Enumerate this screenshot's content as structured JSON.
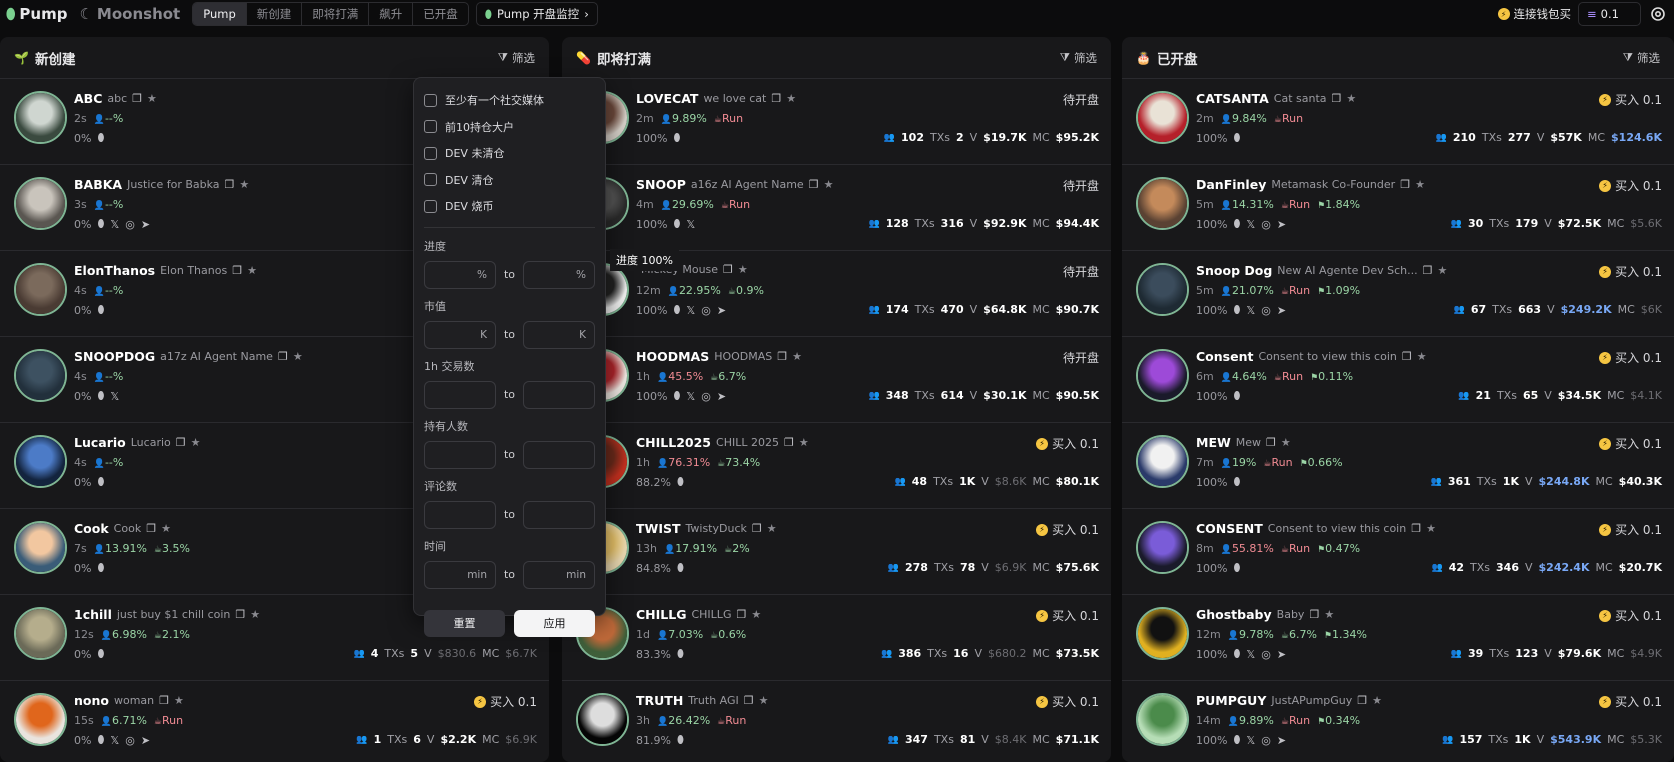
{
  "topbar": {
    "brand1": "Pump",
    "brand2": "Moonshot",
    "tabs": [
      "Pump",
      "新创建",
      "即将打满",
      "飙升",
      "已开盘"
    ],
    "monitor": "Pump 开盘监控",
    "wallet": "连接钱包买",
    "sol_value": "0.1"
  },
  "colors": {
    "accent_green": "#9bd5a6",
    "accent_red": "#f08b93",
    "mc_blue": "#79a8f5",
    "bg": "#0c0c0d",
    "panel": "#18181a"
  },
  "filter_label": "筛选",
  "columns": [
    {
      "title": "新创建",
      "icon": "seedling-icon",
      "rows": [
        {
          "sym": "ABC",
          "name": "abc",
          "age": "2s",
          "p1": "--%",
          "p2": "",
          "p3": "",
          "pct": "0%",
          "links": [],
          "status": "",
          "holders": "",
          "txs": "",
          "vol": "",
          "mc": "",
          "mcblue": false
        },
        {
          "sym": "BABKA",
          "name": "Justice for Babka",
          "age": "3s",
          "p1": "--%",
          "p2": "",
          "p3": "",
          "pct": "0%",
          "links": [
            "x",
            "web",
            "tg"
          ],
          "status": "",
          "holders": "",
          "txs": "",
          "vol": "",
          "mc": "",
          "mcblue": false
        },
        {
          "sym": "ElonThanos",
          "name": "Elon Thanos",
          "age": "4s",
          "p1": "--%",
          "p2": "",
          "p3": "",
          "pct": "0%",
          "links": [],
          "status": "",
          "holders": "",
          "txs": "",
          "vol": "",
          "mc": "",
          "mcblue": false
        },
        {
          "sym": "SNOOPDOG",
          "name": "a17z AI Agent Name",
          "age": "4s",
          "p1": "--%",
          "p2": "",
          "p3": "",
          "pct": "0%",
          "links": [
            "x"
          ],
          "status": "",
          "holders": "",
          "txs": "",
          "vol": "",
          "mc": "",
          "mcblue": false
        },
        {
          "sym": "Lucario",
          "name": "Lucario",
          "age": "4s",
          "p1": "--%",
          "p2": "",
          "p3": "",
          "pct": "0%",
          "links": [],
          "status": "",
          "holders": "",
          "txs": "",
          "vol": "",
          "mc": "",
          "mcblue": false
        },
        {
          "sym": "Cook",
          "name": "Cook",
          "age": "7s",
          "p1": "13.91%",
          "p2": "3.5%",
          "p3": "",
          "pct": "0%",
          "links": [],
          "status": "",
          "holders": "",
          "txs": "",
          "vol": "",
          "mc": "",
          "mcblue": false
        },
        {
          "sym": "1chill",
          "name": "just buy $1 chill coin",
          "age": "12s",
          "p1": "6.98%",
          "p2": "2.1%",
          "p3": "",
          "pct": "0%",
          "links": [],
          "status": "",
          "holders": "4",
          "txs": "5",
          "vol": "$830.6",
          "mc": "$6.7K",
          "mcblue": false,
          "vdim": true,
          "mdim": true
        },
        {
          "sym": "nono",
          "name": "woman",
          "age": "15s",
          "p1": "6.71%",
          "p2": "Run",
          "p3": "",
          "pct": "0%",
          "links": [
            "x",
            "web",
            "tg"
          ],
          "status": "买入 0.1",
          "holders": "1",
          "txs": "6",
          "vol": "$2.2K",
          "mc": "$6.9K",
          "mcblue": false,
          "mdim": true
        }
      ]
    },
    {
      "title": "即将打满",
      "icon": "pill-icon",
      "rows": [
        {
          "sym": "LOVECAT",
          "name": "we love cat",
          "age": "2m",
          "p1": "9.89%",
          "p2": "Run",
          "p3": "",
          "pct": "100%",
          "links": [],
          "status": "待开盘",
          "holders": "102",
          "txs": "2",
          "vol": "$19.7K",
          "mc": "$95.2K"
        },
        {
          "sym": "SNOOP",
          "name": "a16z AI Agent Name",
          "age": "4m",
          "p1": "29.69%",
          "p2": "Run",
          "p3": "",
          "pct": "100%",
          "links": [
            "x"
          ],
          "status": "待开盘",
          "holders": "128",
          "txs": "316",
          "vol": "$92.9K",
          "mc": "$94.4K"
        },
        {
          "sym": "",
          "name": "Mickey Mouse",
          "age": "12m",
          "p1": "22.95%",
          "p2": "0.9%",
          "p3": "",
          "pct": "100%",
          "links": [
            "x",
            "web",
            "tg"
          ],
          "status": "待开盘",
          "holders": "174",
          "txs": "470",
          "vol": "$64.8K",
          "mc": "$90.7K"
        },
        {
          "sym": "HOODMAS",
          "name": "HOODMAS",
          "age": "1h",
          "p1": "45.5%",
          "p2": "6.7%",
          "p3": "",
          "pct": "100%",
          "links": [
            "x",
            "web",
            "tg"
          ],
          "status": "待开盘",
          "holders": "348",
          "txs": "614",
          "vol": "$30.1K",
          "mc": "$90.5K",
          "p1red": true
        },
        {
          "sym": "CHILL2025",
          "name": "CHILL 2025",
          "age": "1h",
          "p1": "76.31%",
          "p2": "73.4%",
          "p3": "",
          "pct": "88.2%",
          "links": [],
          "status": "买入 0.1",
          "holders": "48",
          "txs": "1K",
          "vol": "$8.6K",
          "mc": "$80.1K",
          "p1red": true,
          "vdim": true
        },
        {
          "sym": "TWIST",
          "name": "TwistyDuck",
          "age": "13h",
          "p1": "17.91%",
          "p2": "2%",
          "p3": "",
          "pct": "84.8%",
          "links": [],
          "status": "买入 0.1",
          "holders": "278",
          "txs": "78",
          "vol": "$6.9K",
          "mc": "$75.6K",
          "vdim": true
        },
        {
          "sym": "CHILLG",
          "name": "CHILLG",
          "age": "1d",
          "p1": "7.03%",
          "p2": "0.6%",
          "p3": "",
          "pct": "83.3%",
          "links": [],
          "status": "买入 0.1",
          "holders": "386",
          "txs": "16",
          "vol": "$680.2",
          "mc": "$73.5K",
          "vdim": true
        },
        {
          "sym": "TRUTH",
          "name": "Truth AGI",
          "age": "3h",
          "p1": "26.42%",
          "p2": "Run",
          "p3": "",
          "pct": "81.9%",
          "links": [],
          "status": "买入 0.1",
          "holders": "347",
          "txs": "81",
          "vol": "$8.4K",
          "mc": "$71.1K",
          "vdim": true
        }
      ]
    },
    {
      "title": "已开盘",
      "icon": "cake-icon",
      "rows": [
        {
          "sym": "CATSANTA",
          "name": "Cat santa",
          "age": "2m",
          "p1": "9.84%",
          "p2": "Run",
          "p3": "",
          "pct": "100%",
          "links": [],
          "status": "买入 0.1",
          "holders": "210",
          "txs": "277",
          "vol": "$57K",
          "mc": "$124.6K",
          "mcblue": true
        },
        {
          "sym": "DanFinley",
          "name": "Metamask Co-Founder",
          "age": "5m",
          "p1": "14.31%",
          "p2": "Run",
          "p3": "1.84%",
          "pct": "100%",
          "links": [
            "x",
            "web",
            "tg"
          ],
          "status": "买入 0.1",
          "holders": "30",
          "txs": "179",
          "vol": "$72.5K",
          "mc": "$5.6K",
          "mdim": true
        },
        {
          "sym": "Snoop Dog",
          "name": "New AI Agente Dev Sch...",
          "age": "5m",
          "p1": "21.07%",
          "p2": "Run",
          "p3": "1.09%",
          "pct": "100%",
          "links": [
            "x",
            "web",
            "tg"
          ],
          "status": "买入 0.1",
          "holders": "67",
          "txs": "663",
          "vol": "$249.2K",
          "mc": "$6K",
          "vblue": true,
          "mdim": true
        },
        {
          "sym": "Consent",
          "name": "Consent to view this coin",
          "age": "6m",
          "p1": "4.64%",
          "p2": "Run",
          "p3": "0.11%",
          "pct": "100%",
          "links": [],
          "status": "买入 0.1",
          "holders": "21",
          "txs": "65",
          "vol": "$34.5K",
          "mc": "$4.1K",
          "mdim": true
        },
        {
          "sym": "MEW",
          "name": "Mew",
          "age": "7m",
          "p1": "19%",
          "p2": "Run",
          "p3": "0.66%",
          "pct": "100%",
          "links": [],
          "status": "买入 0.1",
          "holders": "361",
          "txs": "1K",
          "vol": "$244.8K",
          "mc": "$40.3K",
          "vblue": true
        },
        {
          "sym": "CONSENT",
          "name": "Consent to view this coin",
          "age": "8m",
          "p1": "55.81%",
          "p2": "Run",
          "p3": "0.47%",
          "pct": "100%",
          "links": [],
          "status": "买入 0.1",
          "holders": "42",
          "txs": "346",
          "vol": "$242.4K",
          "mc": "$20.7K",
          "vblue": true,
          "p1red": true
        },
        {
          "sym": "Ghostbaby",
          "name": "Baby",
          "age": "12m",
          "p1": "9.78%",
          "p2": "6.7%",
          "p3": "1.34%",
          "pct": "100%",
          "links": [
            "x",
            "web",
            "tg"
          ],
          "status": "买入 0.1",
          "holders": "39",
          "txs": "123",
          "vol": "$79.6K",
          "mc": "$4.9K",
          "mdim": true
        },
        {
          "sym": "PUMPGUY",
          "name": "JustAPumpGuy",
          "age": "14m",
          "p1": "9.89%",
          "p2": "Run",
          "p3": "0.34%",
          "pct": "100%",
          "links": [
            "x",
            "web",
            "tg"
          ],
          "status": "买入 0.1",
          "holders": "157",
          "txs": "1K",
          "vol": "$543.9K",
          "mc": "$5.3K",
          "vblue": true,
          "mdim": true
        }
      ]
    }
  ],
  "popup": {
    "checks": [
      "至少有一个社交媒体",
      "前10持仓大户",
      "DEV 未清仓",
      "DEV 清仓",
      "DEV 烧币"
    ],
    "fields": [
      {
        "label": "进度",
        "unit": "%"
      },
      {
        "label": "市值",
        "unit": "K"
      },
      {
        "label": "1h 交易数",
        "unit": ""
      },
      {
        "label": "持有人数",
        "unit": ""
      },
      {
        "label": "评论数",
        "unit": ""
      },
      {
        "label": "时间",
        "unit": "min"
      }
    ],
    "to": "to",
    "reset": "重置",
    "apply": "应用"
  },
  "tooltip": "进度 100%"
}
